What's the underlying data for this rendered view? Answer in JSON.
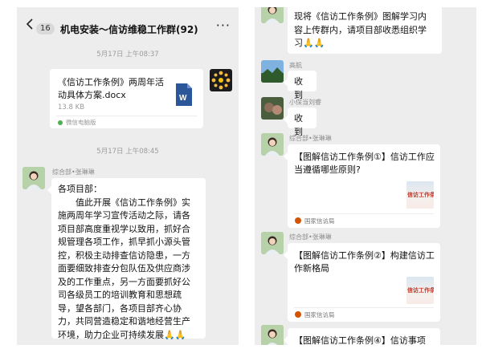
{
  "left": {
    "header": {
      "unread": "16",
      "title": "机电安装～信访维稳工作群(92)",
      "more": "···"
    },
    "time1": "5月17日 上午08:37",
    "file": {
      "name": "《信访工作条例》两周年活动具体方案.docx",
      "size": "13.8 KB",
      "source": "微信电脑版",
      "icon_letter": "W"
    },
    "time2": "5月17日 上午08:45",
    "msg": {
      "sender": "综合部•张琳琳",
      "lines": [
        "各项目部：",
        "　　值此开展《信访工作条例》实",
        "施两周年学习宣传活动之际，请各",
        "项目部高度重视学以致用，抓好合",
        "规管理各项工作，抓早抓小源头管",
        "控，积极主动排查信访隐患，一方",
        "面要细致排查分包队伍及供应商涉",
        "及的工作重点，另一方面要抓好公",
        "司各级员工的培训教育和思想疏",
        "导，望各部门，各项目部齐心协",
        "力，共同营造稳定和谐地经营生产",
        "环境，助力企业可持续发展🙏🙏"
      ]
    }
  },
  "right": {
    "top_msg": {
      "lines": [
        "现将《信访工作条例》图解学习内",
        "容上传群内，请项目部收悉组织学",
        "习🙏🙏"
      ]
    },
    "reply1": {
      "sender": "高航",
      "text": "收到"
    },
    "reply2": {
      "sender": "小保当刘睿",
      "text": "收到"
    },
    "links": [
      {
        "sender": "综合部•张琳琳",
        "title": "【图解信访工作条例①】信访工作应当遵循哪些原则?",
        "thumb": "信访工作条",
        "source": "国家信访局"
      },
      {
        "sender": "综合部•张琳琳",
        "title": "【图解信访工作条例②】构建信访工作新格局",
        "thumb": "信访工作条",
        "source": "国家信访局"
      },
      {
        "sender": "综合部•张琳琳",
        "title": "【图解信访工作条例④】信访事项",
        "thumb": "",
        "source": ""
      }
    ]
  },
  "colors": {
    "panel_bg": "#ededed",
    "bubble": "#ffffff",
    "accent_word": "#2b579a",
    "gov": "#d35400"
  },
  "icons": [
    "back-chevron-icon",
    "more-icon",
    "word-file-icon",
    "group-avatar-icon",
    "user-avatar-icon",
    "gov-source-icon"
  ]
}
